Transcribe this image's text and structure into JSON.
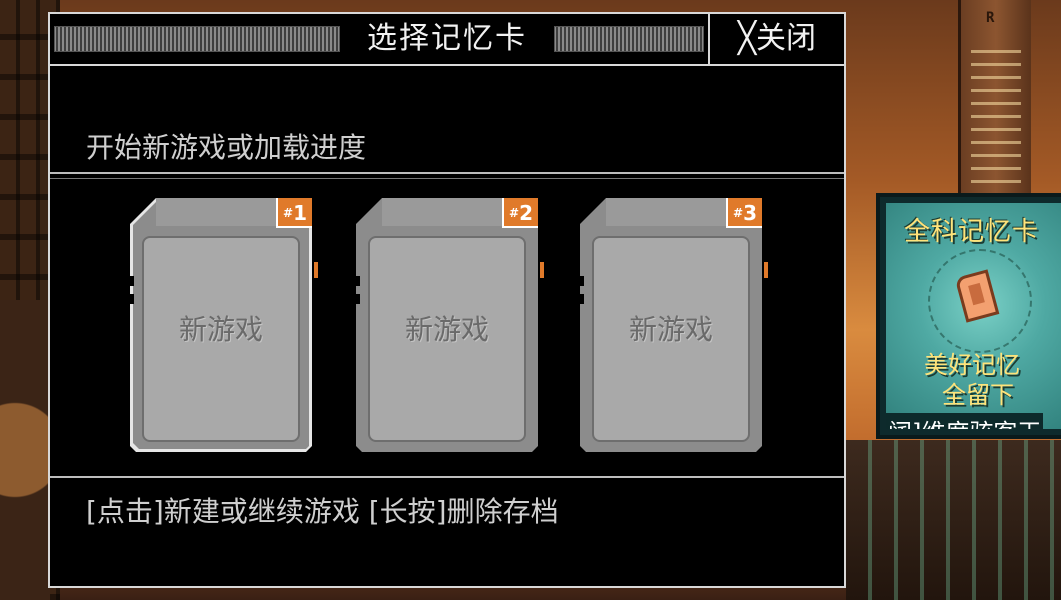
{
  "dialog": {
    "title": "选择记忆卡",
    "close_label": "╳关闭",
    "subtitle": "开始新游戏或加载进度",
    "hint": "[点击]新建或继续游戏 [长按]删除存档"
  },
  "cards": [
    {
      "slot_hash": "#",
      "slot_num": "1",
      "label": "新游戏",
      "selected": true
    },
    {
      "slot_hash": "#",
      "slot_num": "2",
      "label": "新游戏",
      "selected": false
    },
    {
      "slot_hash": "#",
      "slot_num": "3",
      "label": "新游戏",
      "selected": false
    }
  ],
  "billboard": {
    "title": "全科记忆卡",
    "line1": "美好记忆",
    "line2": "全留下",
    "ticker": "阔]维度骇客王"
  },
  "background": {
    "tower_letter": "R"
  },
  "colors": {
    "accent_orange": "#e07a2a",
    "dialog_bg": "#000000",
    "card_gray": "#a9a9a9",
    "billboard_text": "#ffe37a"
  }
}
